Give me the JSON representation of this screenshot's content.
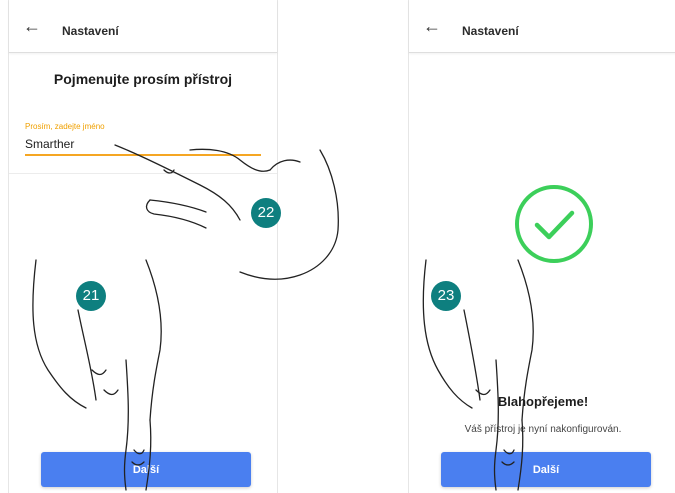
{
  "left_screen": {
    "appbar": {
      "back_icon": "arrow-left-icon",
      "title": "Nastavení"
    },
    "heading": "Pojmenujte prosím přístroj",
    "name_field": {
      "label": "Prosím, zadejte jméno",
      "value": "Smarther"
    },
    "next_button": "Další"
  },
  "right_screen": {
    "appbar": {
      "back_icon": "arrow-left-icon",
      "title": "Nastavení"
    },
    "success_icon": "check-circle-icon",
    "congrats": "Blahopřejeme!",
    "message": "Váš přístroj je nyní nakonfigurován.",
    "next_button": "Další"
  },
  "step_badges": [
    "21",
    "22",
    "23"
  ],
  "colors": {
    "accent_orange": "#f5a623",
    "button_blue": "#4a7ff0",
    "success_green": "#3ccf5a",
    "badge_teal": "#0e7f7f"
  }
}
